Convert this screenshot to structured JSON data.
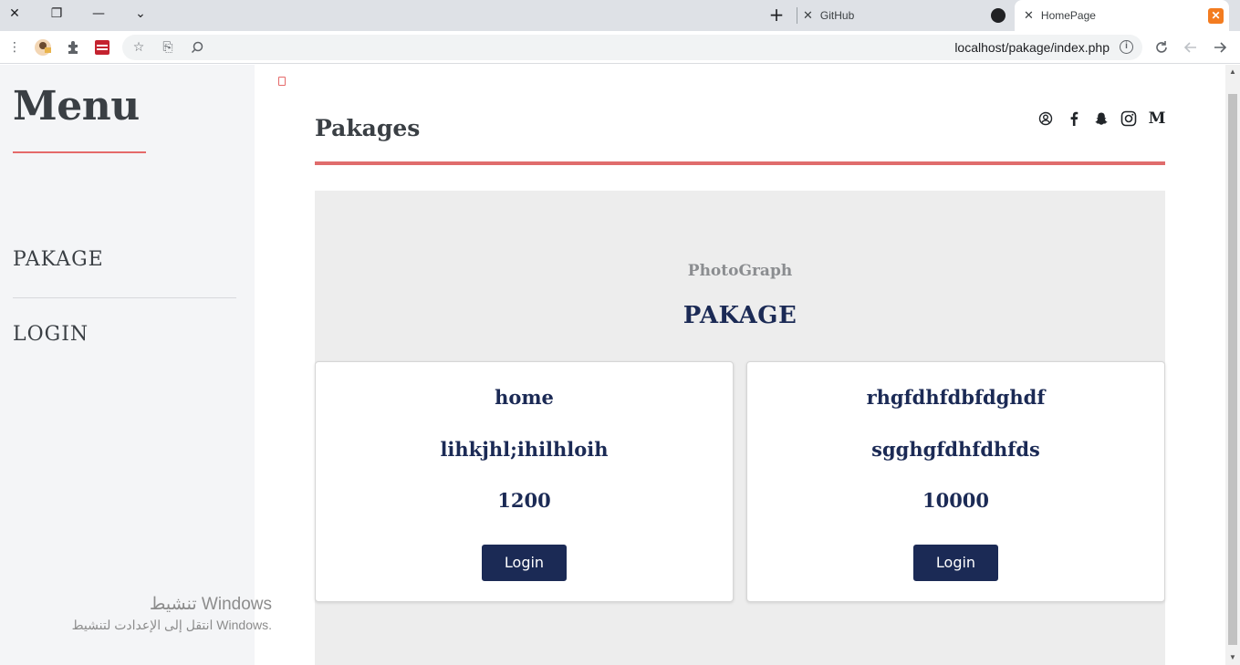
{
  "browser": {
    "tabs": [
      {
        "title": "GitHub",
        "active": false,
        "favicon": "github-icon"
      },
      {
        "title": "HomePage",
        "active": true,
        "favicon": "xampp-icon"
      }
    ],
    "url": "localhost/pakage/index.php"
  },
  "sidebar": {
    "title": "Menu",
    "items": [
      {
        "label": "PAKAGE"
      },
      {
        "label": "LOGIN"
      }
    ]
  },
  "header": {
    "title": "Pakages",
    "social_icons": [
      "account-icon",
      "facebook-icon",
      "snapchat-icon",
      "instagram-icon",
      "medium-icon"
    ]
  },
  "section": {
    "subtitle": "PhotoGraph",
    "title": "PAKAGE"
  },
  "cards": [
    {
      "name": "home",
      "description": "lihkjhl;ihilhloih",
      "price": "1200",
      "button": "Login"
    },
    {
      "name": "rhgfdhfdbfdghdf",
      "description": "sgghgfdhfdhfds",
      "price": "10000",
      "button": "Login"
    }
  ],
  "watermark": {
    "line1": "تنشيط Windows",
    "line2": "انتقل إلى الإعدادت لتنشيط Windows."
  },
  "colors": {
    "accent_red": "#e06c6c",
    "navy": "#1b2a55",
    "section_bg": "#ededed",
    "sidebar_bg": "#f4f5f7"
  }
}
